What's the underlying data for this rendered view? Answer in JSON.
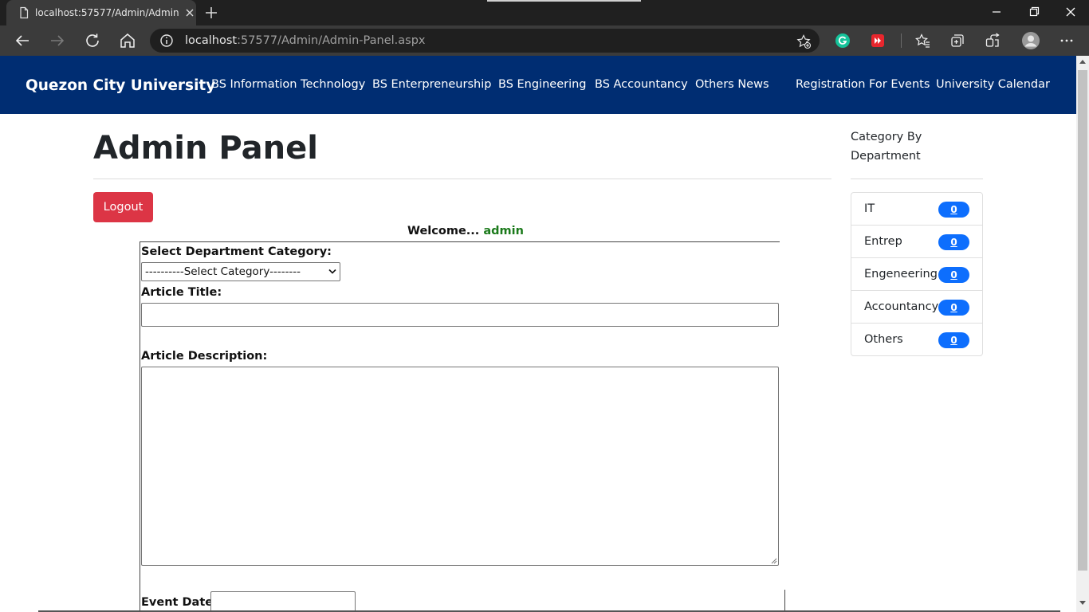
{
  "browser": {
    "tab_title": "localhost:57577/Admin/Admin-Panel.aspx",
    "address_host": "localhost",
    "address_path": ":57577/Admin/Admin-Panel.aspx"
  },
  "navbar": {
    "brand": "Quezon City University",
    "items": [
      {
        "label": "BS Information Technology"
      },
      {
        "label": "BS Enterpreneurship"
      },
      {
        "label": "BS Engineering"
      },
      {
        "label": "BS Accountancy"
      },
      {
        "label": "Others News"
      },
      {
        "label": "Registration For Events"
      },
      {
        "label": "University Calendar"
      }
    ]
  },
  "main": {
    "title": "Admin Panel",
    "logout_label": "Logout",
    "welcome_label": "Welcome...",
    "welcome_user": "admin"
  },
  "form": {
    "category_label": "Select Department Category:",
    "category_selected": "----------Select Category--------",
    "title_label": "Article Title:",
    "description_label": "Article Description:",
    "event_date_label": "Event Date:"
  },
  "sidebar": {
    "title": "Category By Department",
    "items": [
      {
        "label": "IT",
        "count": "0"
      },
      {
        "label": "Entrep",
        "count": "0"
      },
      {
        "label": "Engeneering",
        "count": "0"
      },
      {
        "label": "Accountancy",
        "count": "0"
      },
      {
        "label": "Others",
        "count": "0"
      }
    ]
  },
  "colors": {
    "navbar": "#002d72",
    "logout": "#dc3545",
    "badge": "#0d6efd",
    "welcome_user": "#1b7a1b"
  }
}
